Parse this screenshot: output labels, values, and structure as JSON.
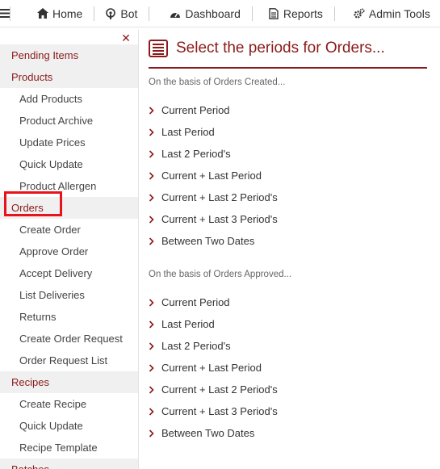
{
  "topbar": {
    "home_label": "Home",
    "bot_label": "Bot",
    "dashboard_label": "Dashboard",
    "reports_label": "Reports",
    "admin_label": "Admin Tools"
  },
  "sidebar": {
    "items": [
      {
        "label": "Pending Items",
        "type": "group"
      },
      {
        "label": "Products",
        "type": "group"
      },
      {
        "label": "Add Products",
        "type": "sub"
      },
      {
        "label": "Product Archive",
        "type": "sub"
      },
      {
        "label": "Update Prices",
        "type": "sub"
      },
      {
        "label": "Quick Update",
        "type": "sub"
      },
      {
        "label": "Product Allergen",
        "type": "sub"
      },
      {
        "label": "Orders",
        "type": "group"
      },
      {
        "label": "Create Order",
        "type": "sub"
      },
      {
        "label": "Approve Order",
        "type": "sub"
      },
      {
        "label": "Accept Delivery",
        "type": "sub"
      },
      {
        "label": "List Deliveries",
        "type": "sub"
      },
      {
        "label": "Returns",
        "type": "sub"
      },
      {
        "label": "Create Order Request",
        "type": "sub"
      },
      {
        "label": "Order Request List",
        "type": "sub"
      },
      {
        "label": "Recipes",
        "type": "group"
      },
      {
        "label": "Create Recipe",
        "type": "sub"
      },
      {
        "label": "Quick Update",
        "type": "sub"
      },
      {
        "label": "Recipe Template",
        "type": "sub"
      },
      {
        "label": "Batches",
        "type": "group"
      }
    ]
  },
  "main": {
    "title": "Select the periods for Orders...",
    "created_label": "On the basis of Orders Created...",
    "approved_label": "On the basis of Orders Approved...",
    "created_periods": [
      "Current Period",
      "Last Period",
      "Last 2 Period's",
      "Current + Last Period",
      "Current + Last 2 Period's",
      "Current + Last 3 Period's",
      "Between Two Dates"
    ],
    "approved_periods": [
      "Current Period",
      "Last Period",
      "Last 2 Period's",
      "Current + Last Period",
      "Current + Last 2 Period's",
      "Current + Last 3 Period's",
      "Between Two Dates"
    ]
  },
  "colors": {
    "accent": "#8b1a1a",
    "highlight_box": "#e8141b",
    "group_bg": "#f0f0f0"
  }
}
